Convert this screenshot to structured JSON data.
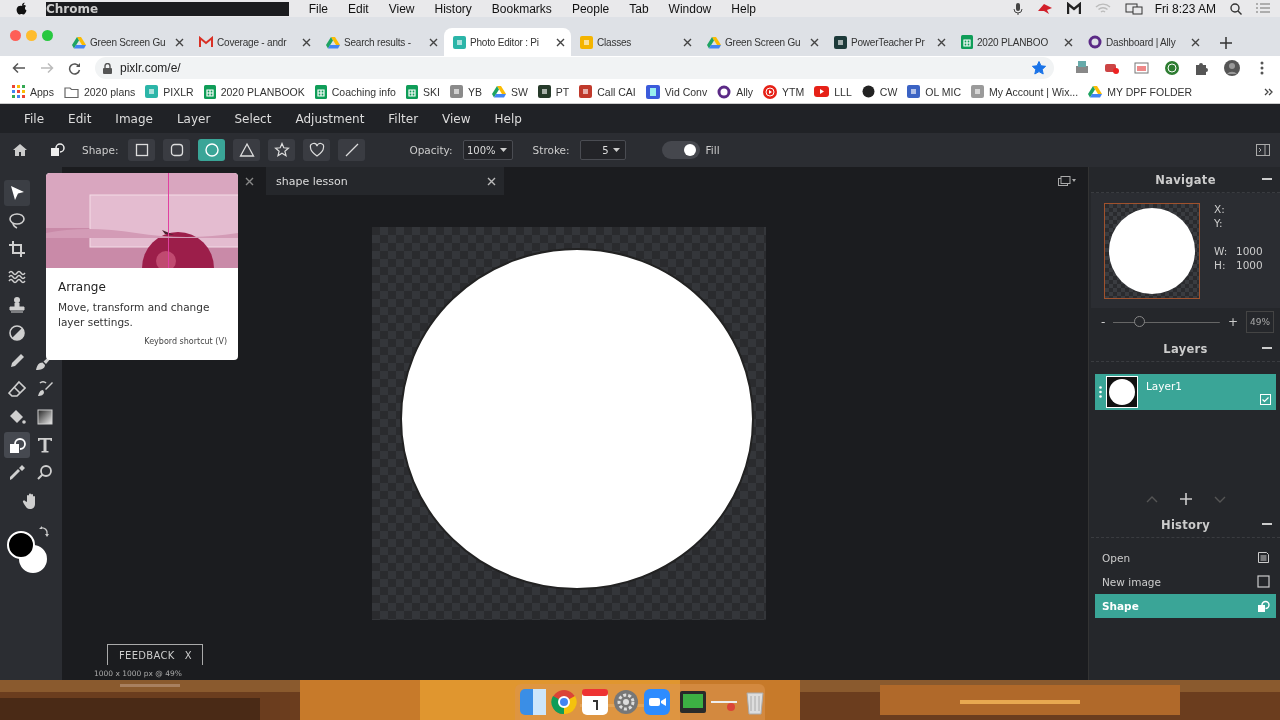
{
  "menubar": {
    "app": "Chrome",
    "menus": [
      "File",
      "Edit",
      "View",
      "History",
      "Bookmarks",
      "People",
      "Tab",
      "Window",
      "Help"
    ],
    "clock": "Fri 8:23 AM"
  },
  "browser": {
    "tabs": [
      {
        "title": "Green Screen Gu",
        "selected": false
      },
      {
        "title": "Coverage - andr",
        "selected": false
      },
      {
        "title": "Search results -",
        "selected": false
      },
      {
        "title": "Photo Editor : Pi",
        "selected": true
      },
      {
        "title": "Classes",
        "selected": false
      },
      {
        "title": "Green Screen Gu",
        "selected": false
      },
      {
        "title": "PowerTeacher Pr",
        "selected": false
      },
      {
        "title": "2020 PLANBOO",
        "selected": false
      },
      {
        "title": "Dashboard | Ally",
        "selected": false
      }
    ],
    "url": "pixlr.com/e/",
    "bookmarked": true,
    "bookmarks": [
      {
        "label": "Apps"
      },
      {
        "label": "2020 plans"
      },
      {
        "label": "PIXLR"
      },
      {
        "label": "2020 PLANBOOK"
      },
      {
        "label": "Coaching info"
      },
      {
        "label": "SKI"
      },
      {
        "label": "YB"
      },
      {
        "label": "SW"
      },
      {
        "label": "PT"
      },
      {
        "label": "Call CAI"
      },
      {
        "label": "Vid Conv"
      },
      {
        "label": "Ally"
      },
      {
        "label": "YTM"
      },
      {
        "label": "LLL"
      },
      {
        "label": "CW"
      },
      {
        "label": "OL MIC"
      },
      {
        "label": "My Account | Wix..."
      },
      {
        "label": "MY DPF FOLDER"
      }
    ]
  },
  "editor": {
    "menus": [
      "File",
      "Edit",
      "Image",
      "Layer",
      "Select",
      "Adjustment",
      "Filter",
      "View",
      "Help"
    ],
    "options": {
      "shape_label": "Shape:",
      "shapes": [
        {
          "selected": false
        },
        {
          "selected": false
        },
        {
          "selected": true
        },
        {
          "selected": false
        },
        {
          "selected": false
        },
        {
          "selected": false
        },
        {
          "selected": false
        }
      ],
      "opacity_label": "Opacity:",
      "opacity": "100%",
      "stroke_label": "Stroke:",
      "stroke": "5",
      "fill_on": true,
      "fill_label": "Fill"
    },
    "tools": [
      {
        "selected": false,
        "hovered": true
      },
      {
        "selected": false,
        "hovered": false
      },
      {
        "selected": false,
        "hovered": false
      },
      {
        "selected": false,
        "hovered": false
      },
      {
        "selected": false,
        "hovered": false
      },
      {
        "selected": false,
        "hovered": false
      },
      {
        "selected": false,
        "hovered": false
      },
      {
        "selected": false,
        "hovered": false
      },
      {
        "selected": false,
        "hovered": false
      },
      {
        "selected": false,
        "hovered": false
      },
      {
        "selected": false,
        "hovered": false
      },
      {
        "selected": false,
        "hovered": false
      },
      {
        "selected": true,
        "hovered": false
      },
      {
        "selected": false,
        "hovered": false
      },
      {
        "selected": false,
        "hovered": false
      },
      {
        "selected": false,
        "hovered": false
      },
      {
        "selected": false,
        "hovered": false
      }
    ],
    "swatches": [
      {
        "color": "#000000"
      },
      {
        "color": "#ffffff"
      }
    ],
    "tooltip": {
      "title": "Arrange",
      "text": "Move, transform and change layer settings.",
      "shortcut": "Keybord shortcut (V)"
    },
    "doc_tabs": [
      {
        "title": "shape lesson",
        "selected": true
      }
    ],
    "navigate": {
      "title": "Navigate",
      "fields": [
        {
          "label": "X:"
        },
        {
          "label": "Y:"
        },
        {
          "label": "W:",
          "value": "1000"
        },
        {
          "label": "H:",
          "value": "1000"
        }
      ],
      "zoom_out": "-",
      "zoom_in": "+",
      "zoom": {
        "level": 0.24
      },
      "zoom_value": "49%"
    },
    "layers": {
      "title": "Layers",
      "items": [
        {
          "name": "Layer1",
          "selected": true,
          "checked": true
        }
      ]
    },
    "history": {
      "title": "History",
      "items": [
        {
          "label": "Open",
          "selected": false
        },
        {
          "label": "New image",
          "selected": false
        },
        {
          "label": "Shape",
          "selected": true
        }
      ]
    },
    "feedback": {
      "label": "FEEDBACK",
      "close": "X"
    },
    "status": "1000 x 1000 px @ 49%"
  }
}
